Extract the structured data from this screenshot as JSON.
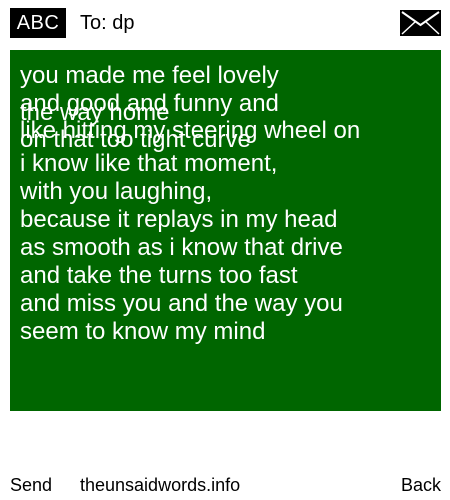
{
  "header": {
    "input_mode": "ABC",
    "recipient": "To: dp",
    "envelope_icon": "envelope-icon"
  },
  "message": {
    "lines": [
      "you made me feel lovely",
      "and good and funny and",
      "the way home",
      "like hitting my steering wheel on",
      "on that too tight curve",
      "i know like that moment,",
      "with you laughing,",
      "because it replays in my head",
      "as smooth as i know that drive",
      "and take the turns too fast",
      "and miss you and the way you",
      "seem to know my mind"
    ]
  },
  "footer": {
    "send_label": "Send",
    "site_label": "theunsaidwords.info",
    "back_label": "Back"
  },
  "colors": {
    "message_background": "#006600",
    "message_text": "#ffffff",
    "badge_background": "#000000"
  }
}
